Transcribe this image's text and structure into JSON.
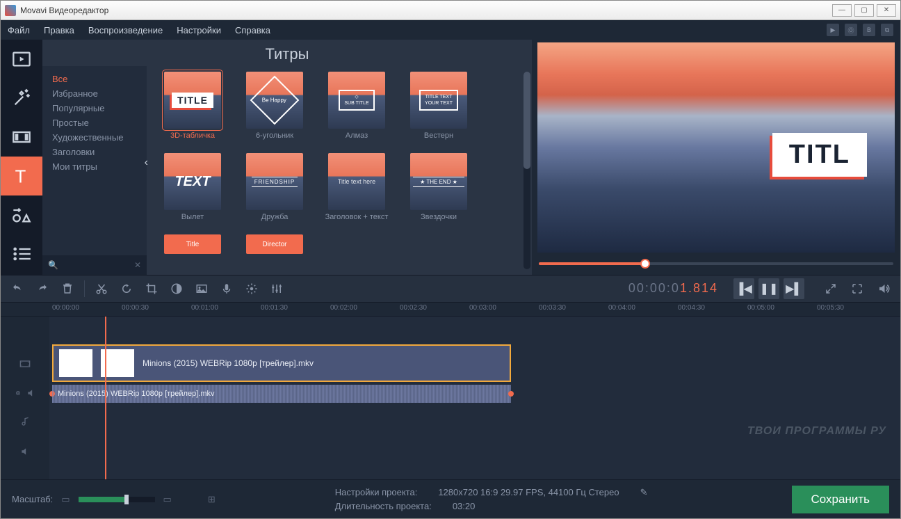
{
  "window": {
    "title": "Movavi Видеоредактор"
  },
  "menu": [
    "Файл",
    "Правка",
    "Воспроизведение",
    "Настройки",
    "Справка"
  ],
  "panel_title": "Титры",
  "categories": [
    "Все",
    "Избранное",
    "Популярные",
    "Простые",
    "Художественные",
    "Заголовки",
    "Мои титры"
  ],
  "active_category": "Все",
  "titles": [
    {
      "label": "3D-табличка",
      "selected": true,
      "overlay": "TITLE"
    },
    {
      "label": "6-угольник",
      "overlay": "Be Happy"
    },
    {
      "label": "Алмаз",
      "overlay": "SUB TITLE"
    },
    {
      "label": "Вестерн",
      "overlay": "YOUR TEXT"
    },
    {
      "label": "Вылет",
      "overlay": "TEXT"
    },
    {
      "label": "Дружба",
      "overlay": "FRIENDSHIP"
    },
    {
      "label": "Заголовок + текст",
      "overlay": "Title text here"
    },
    {
      "label": "Звездочки",
      "overlay": "THE END"
    },
    {
      "label": "",
      "overlay": "Title",
      "half": true
    },
    {
      "label": "",
      "overlay": "Director",
      "half": true
    }
  ],
  "preview": {
    "title_text": "TITL",
    "scrub_pct": 30
  },
  "timecode": {
    "base": "00:00:0",
    "hl": "1.814"
  },
  "ruler": [
    "00:00:00",
    "00:00:30",
    "00:01:00",
    "00:01:30",
    "00:02:00",
    "00:02:30",
    "00:03:00",
    "00:03:30",
    "00:04:00",
    "00:04:30",
    "00:05:00",
    "00:05:30"
  ],
  "clips": {
    "video": "Minions (2015) WEBRip 1080p [трейлер].mkv",
    "audio": "Minions (2015) WEBRip 1080p [трейлер].mkv"
  },
  "footer": {
    "zoom_label": "Масштаб:",
    "settings_label": "Настройки проекта:",
    "settings_value": "1280x720 16:9 29.97 FPS, 44100 Гц Стерео",
    "duration_label": "Длительность проекта:",
    "duration_value": "03:20",
    "save": "Сохранить"
  },
  "watermark": "ТВОИ ПРОГРАММЫ РУ"
}
